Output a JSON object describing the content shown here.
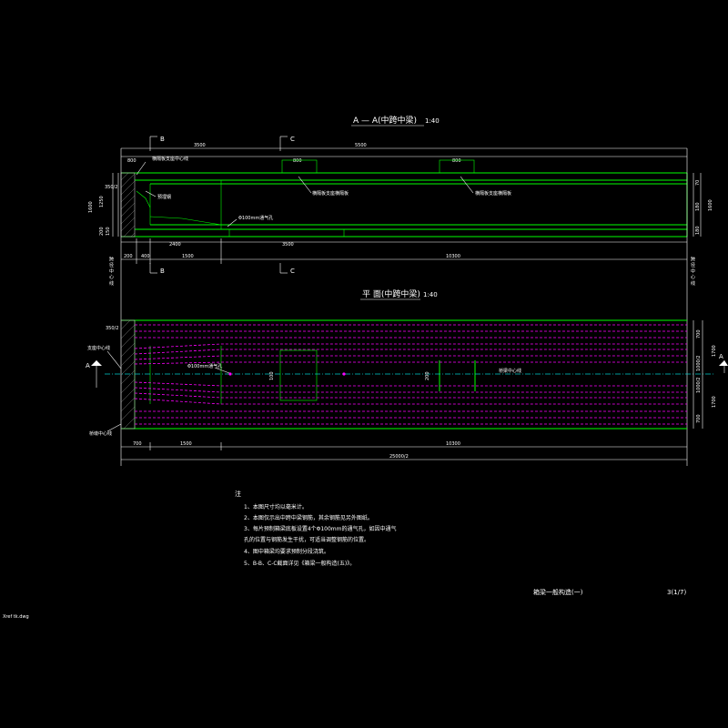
{
  "section_title": "A — A(中跨中梁)",
  "section_scale": "1:40",
  "plan_title": "平 面(中跨中梁)",
  "plan_scale": "1:40",
  "cut_labels": {
    "b_top": "B",
    "c_top": "C",
    "b_bot": "B",
    "c_bot": "C",
    "a_left": "A",
    "a_right": "A"
  },
  "section_dims_top": [
    "800",
    "3500",
    "5500",
    "800",
    "800"
  ],
  "section_dims_bottom": [
    "200",
    "400",
    "1500",
    "2400",
    "3500",
    "10300"
  ],
  "section_dims_left": [
    "350/2",
    "1600",
    "1250",
    "200",
    "150"
  ],
  "section_dims_right": [
    "70",
    "180",
    "1600",
    "180"
  ],
  "section_labels": [
    "横隔板支座中心线",
    "横隔板支座横隔板",
    "横隔板支座横隔板",
    "预埋钢",
    "Φ100mm通气孔"
  ],
  "plan_dims_left": [
    "350/2",
    "支座中心线",
    "桥墩中心线"
  ],
  "plan_dims_right": [
    "700",
    "1700",
    "1000/2",
    "1000/2",
    "1700",
    "700"
  ],
  "plan_dims_bottom": [
    "700",
    "1500",
    "10300",
    "25000/2"
  ],
  "plan_labels": [
    "Φ100mm通气孔",
    "100",
    "200",
    "桥梁中心线"
  ],
  "left_vertical_label": "跨 径 中 心 线",
  "right_vertical_label": "跨 径 中 心 线",
  "notes_heading": "注",
  "notes": [
    "1、本图尺寸均以毫米计。",
    "2、本图仅示出中跨中梁钢筋，其余钢筋见另外图纸。",
    "3、每片预制箱梁底板设置4个Φ100mm的通气孔，如因中通气",
    "   孔的位置与钢筋发生干扰，可适当调整钢筋的位置。",
    "4、图中箱梁均要求预制分段浇筑。",
    "5、B-B、C-C截面详见《箱梁一般构造(五)》。"
  ],
  "drawing_title": "箱梁一般构造(一)",
  "sheet_number": "3(1/7)",
  "file_name": "Xref tk.dwg",
  "colors": {
    "background": "#000000",
    "concrete": "#00ff00",
    "tendon": "#ff00ff",
    "centerline": "#00cccc",
    "text": "#ffffff"
  }
}
